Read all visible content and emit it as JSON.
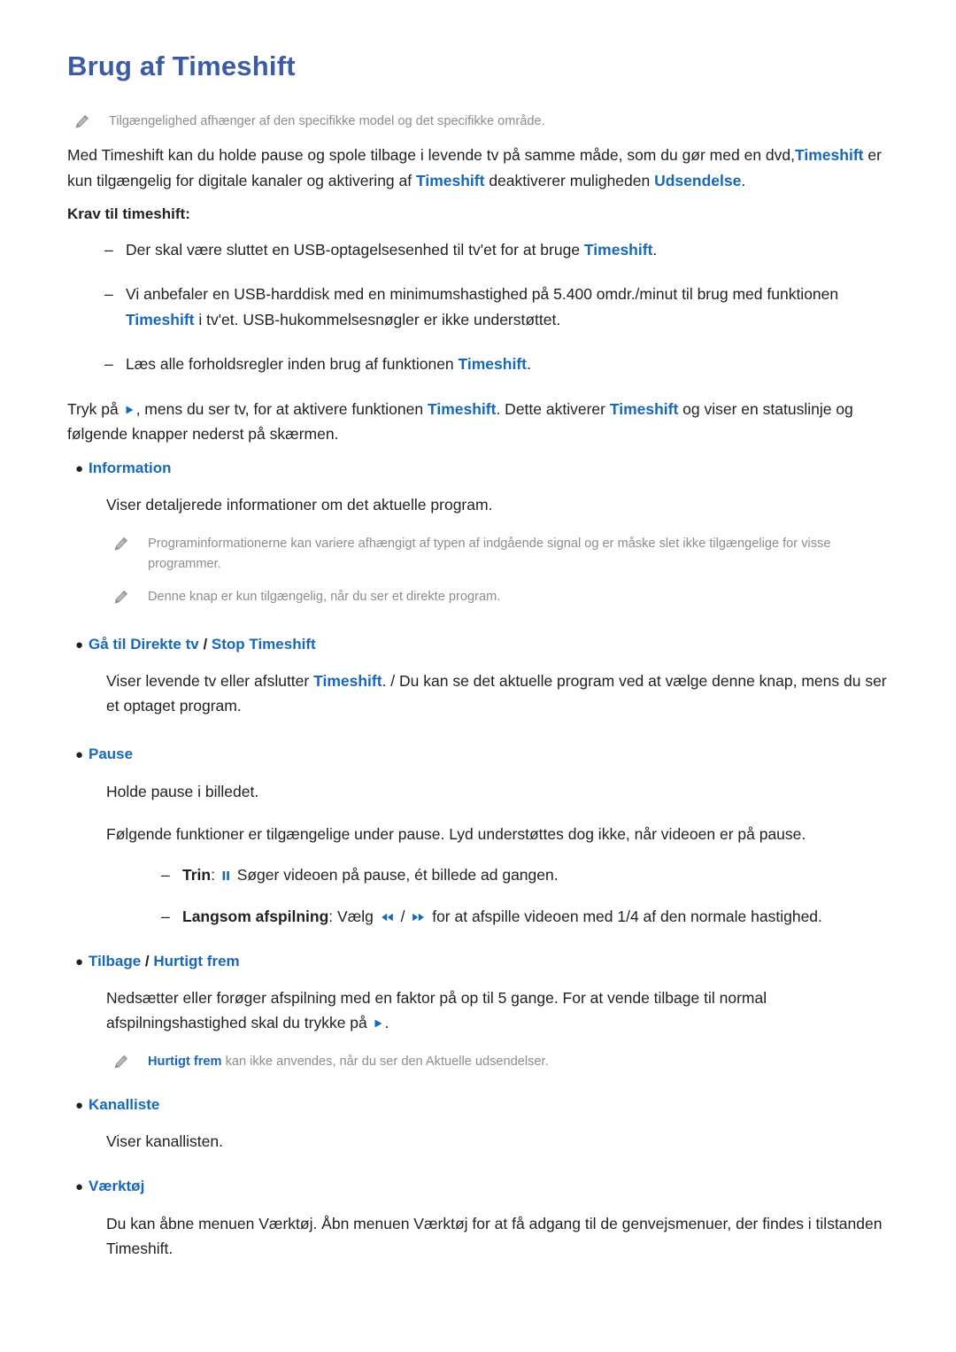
{
  "colors": {
    "title_blue": "#3b5ba5",
    "keyword_blue": "#1768b8",
    "body_text": "#231f20",
    "note_gray": "#8d8d8d",
    "background": "#ffffff"
  },
  "page": {
    "title": "Brug af Timeshift"
  },
  "top_note": {
    "icon": "pencil-icon",
    "text": "Tilgængelighed afhænger af den specifikke model og det specifikke område."
  },
  "intro": {
    "line_part1": "Med Timeshift kan du holde pause og spole tilbage i levende tv på samme måde, som du gør med en dvd,",
    "kw1": "Timeshift",
    "line_part2": " er kun tilgængelig for digitale kanaler og aktivering af ",
    "kw2": "Timeshift",
    "line_part3": " deaktiverer muligheden ",
    "kw3": "Udsendelse",
    "line_part4": "."
  },
  "requirements": {
    "heading": "Krav til timeshift:",
    "marker": "–",
    "items": [
      {
        "part1": "Der skal være sluttet en USB-optagelsesenhed til tv'et for at bruge ",
        "kw1": "Timeshift",
        "part2": "."
      },
      {
        "part1": "Vi anbefaler en USB-harddisk med en minimumshastighed på 5.400 omdr./minut til brug med funktionen ",
        "kw1": "Timeshift",
        "part2": " i tv'et. USB-hukommelsesnøgler er ikke understøttet."
      },
      {
        "part1": "Læs alle forholdsregler inden brug af funktionen ",
        "kw1": "Timeshift",
        "part2": "."
      }
    ]
  },
  "activate": {
    "part1": "Tryk på ",
    "glyph": "play-icon",
    "part2": ", mens du ser tv, for at aktivere funktionen ",
    "kw1": "Timeshift",
    "part3": ". Dette aktiverer ",
    "kw2": "Timeshift",
    "part4": " og viser en statuslinje og følgende knapper nederst på skærmen."
  },
  "bullet_marker": "●",
  "sections": {
    "information": {
      "label": "Information",
      "body": "Viser detaljerede informationer om det aktuelle program.",
      "notes": [
        "Programinformationerne kan variere afhængigt af typen af indgående signal og er måske slet ikke tilgængelige for visse programmer.",
        "Denne knap er kun tilgængelig, når du ser et direkte program."
      ]
    },
    "live_tv": {
      "label_part1": "Gå til Direkte tv",
      "label_sep": " / ",
      "label_part2": "Stop Timeshift",
      "body_part1": "Viser levende tv eller afslutter ",
      "body_kw": "Timeshift",
      "body_part2": ". / Du kan se det aktuelle program ved at vælge denne knap, mens du ser et optaget program."
    },
    "pause": {
      "label": "Pause",
      "body1": "Holde pause i billedet.",
      "body2": "Følgende funktioner er tilgængelige under pause. Lyd understøttes dog ikke, når videoen er på pause.",
      "marker": "–",
      "sub_items": [
        {
          "term": "Trin",
          "colon": ": ",
          "glyph": "pause-icon",
          "text": " Søger videoen på pause, ét billede ad gangen."
        },
        {
          "term": "Langsom afspilning",
          "colon": ": ",
          "pre_text": "Vælg ",
          "glyph1": "rewind-icon",
          "slash": " / ",
          "glyph2": "fast-forward-icon",
          "text": " for at afspille videoen med 1/4 af den normale hastighed."
        }
      ]
    },
    "rewind_forward": {
      "label_part1": "Tilbage",
      "label_sep": " / ",
      "label_part2": "Hurtigt frem",
      "body_part1": "Nedsætter eller forøger afspilning med en faktor på op til 5 gange. For at vende tilbage til normal afspilningshastighed skal du trykke på ",
      "glyph": "play-icon",
      "body_part2": ".",
      "note_kw": "Hurtigt frem",
      "note_text": " kan ikke anvendes, når du ser den Aktuelle udsendelser."
    },
    "channel_list": {
      "label": "Kanalliste",
      "body": "Viser kanallisten."
    },
    "tools": {
      "label": "Værktøj",
      "body": "Du kan åbne menuen Værktøj. Åbn menuen Værktøj for at få adgang til de genvejsmenuer, der findes i tilstanden Timeshift."
    }
  }
}
